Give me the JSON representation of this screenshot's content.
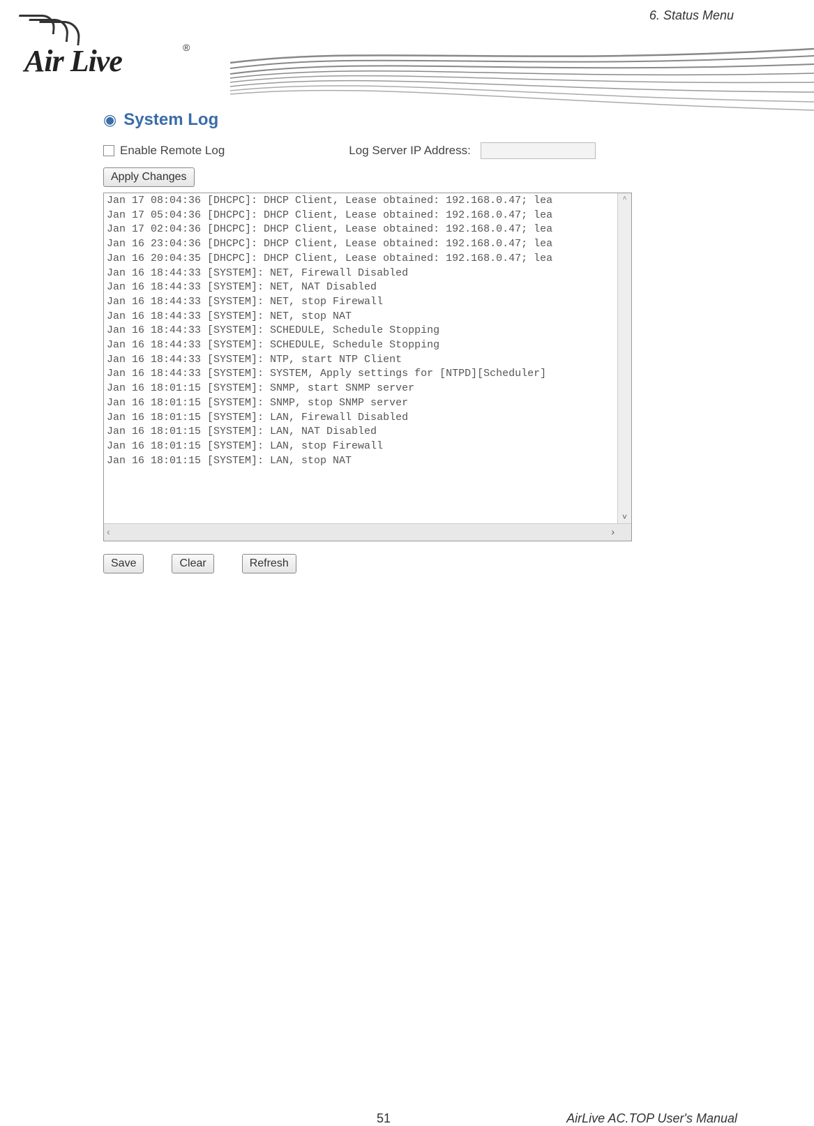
{
  "header": {
    "section": "6. Status Menu"
  },
  "logo": {
    "text": "Air Live",
    "registered": "®"
  },
  "panel": {
    "title": "System Log",
    "enableRemoteLogLabel": "Enable Remote Log",
    "logServerLabel": "Log Server IP Address:",
    "logServerValue": "",
    "applyButton": "Apply Changes",
    "saveButton": "Save",
    "clearButton": "Clear",
    "refreshButton": "Refresh",
    "logLines": [
      "Jan 17 08:04:36 [DHCPC]: DHCP Client, Lease obtained: 192.168.0.47; lea",
      "Jan 17 05:04:36 [DHCPC]: DHCP Client, Lease obtained: 192.168.0.47; lea",
      "Jan 17 02:04:36 [DHCPC]: DHCP Client, Lease obtained: 192.168.0.47; lea",
      "Jan 16 23:04:36 [DHCPC]: DHCP Client, Lease obtained: 192.168.0.47; lea",
      "Jan 16 20:04:35 [DHCPC]: DHCP Client, Lease obtained: 192.168.0.47; lea",
      "Jan 16 18:44:33 [SYSTEM]: NET, Firewall Disabled",
      "Jan 16 18:44:33 [SYSTEM]: NET, NAT Disabled",
      "Jan 16 18:44:33 [SYSTEM]: NET, stop Firewall",
      "Jan 16 18:44:33 [SYSTEM]: NET, stop NAT",
      "Jan 16 18:44:33 [SYSTEM]: SCHEDULE, Schedule Stopping",
      "Jan 16 18:44:33 [SYSTEM]: SCHEDULE, Schedule Stopping",
      "Jan 16 18:44:33 [SYSTEM]: NTP, start NTP Client",
      "Jan 16 18:44:33 [SYSTEM]: SYSTEM, Apply settings for [NTPD][Scheduler]",
      "Jan 16 18:01:15 [SYSTEM]: SNMP, start SNMP server",
      "Jan 16 18:01:15 [SYSTEM]: SNMP, stop SNMP server",
      "Jan 16 18:01:15 [SYSTEM]: LAN, Firewall Disabled",
      "Jan 16 18:01:15 [SYSTEM]: LAN, NAT Disabled",
      "Jan 16 18:01:15 [SYSTEM]: LAN, stop Firewall",
      "Jan 16 18:01:15 [SYSTEM]: LAN, stop NAT"
    ]
  },
  "footer": {
    "pageNumber": "51",
    "manualTitle": "AirLive AC.TOP User's Manual"
  }
}
